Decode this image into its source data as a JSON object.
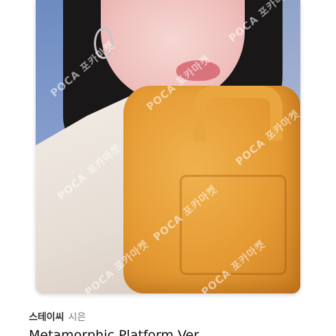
{
  "listing": {
    "artist": "스테이씨",
    "member": "시은",
    "title": "Metamorphic Platform Ver"
  },
  "photo": {
    "watermark_text": "POCA 포카마켓"
  },
  "colors": {
    "bag": "#e59a33",
    "hair": "#1a1719",
    "background": "#8fa3c9"
  }
}
